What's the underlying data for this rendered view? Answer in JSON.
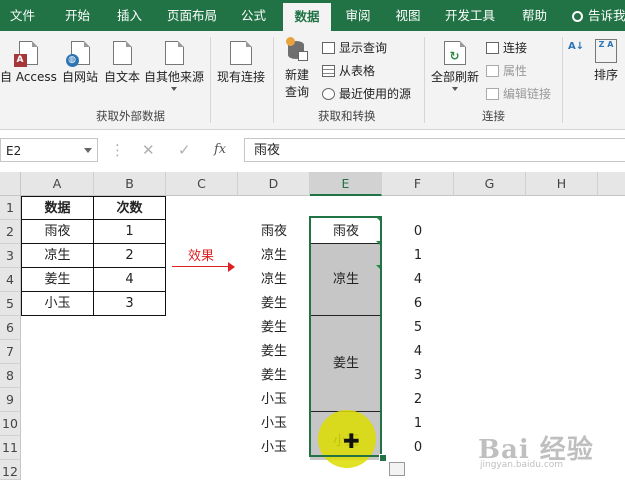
{
  "ribbon": {
    "tabs": [
      "文件",
      "开始",
      "插入",
      "页面布局",
      "公式",
      "数据",
      "审阅",
      "视图",
      "开发工具",
      "帮助"
    ],
    "active_tab": "数据",
    "tell_me": "告诉我",
    "groups": {
      "external": {
        "name": "获取外部数据",
        "access": "自 Access",
        "web": "自网站",
        "text": "自文本",
        "other": "自其他来源",
        "existing": "现有连接"
      },
      "transform": {
        "name": "获取和转换",
        "new_query_1": "新建",
        "new_query_2": "查询",
        "show_queries": "显示查询",
        "from_table": "从表格",
        "recent_sources": "最近使用的源"
      },
      "connections": {
        "name": "连接",
        "refresh_all": "全部刷新",
        "connections": "连接",
        "properties": "属性",
        "edit_links": "编辑链接"
      },
      "sort": {
        "sort": "排序",
        "za": "Z A"
      }
    }
  },
  "formula_bar": {
    "name_box": "E2",
    "cancel": "✕",
    "enter": "✓",
    "fx": "fx",
    "value": "雨夜"
  },
  "sheet": {
    "columns": [
      "A",
      "B",
      "C",
      "D",
      "E",
      "F",
      "G",
      "H"
    ],
    "rows": [
      "1",
      "2",
      "3",
      "4",
      "5",
      "6",
      "7",
      "8",
      "9",
      "10",
      "11",
      "12"
    ],
    "table_header": [
      "数据",
      "次数"
    ],
    "table_rows": [
      [
        "雨夜",
        "1"
      ],
      [
        "凉生",
        "2"
      ],
      [
        "姜生",
        "4"
      ],
      [
        "小玉",
        "3"
      ]
    ],
    "arrow_label": "效果",
    "col_d": [
      "雨夜",
      "凉生",
      "凉生",
      "姜生",
      "姜生",
      "姜生",
      "姜生",
      "小玉",
      "小玉",
      "小玉"
    ],
    "col_e_merged": [
      "雨夜",
      "凉生",
      "姜生",
      "小玉"
    ],
    "col_f": [
      "0",
      "1",
      "4",
      "6",
      "5",
      "4",
      "3",
      "2",
      "1",
      "0"
    ]
  },
  "watermark": {
    "text": "Bai 经验",
    "sub": "jingyan.baidu.com"
  }
}
